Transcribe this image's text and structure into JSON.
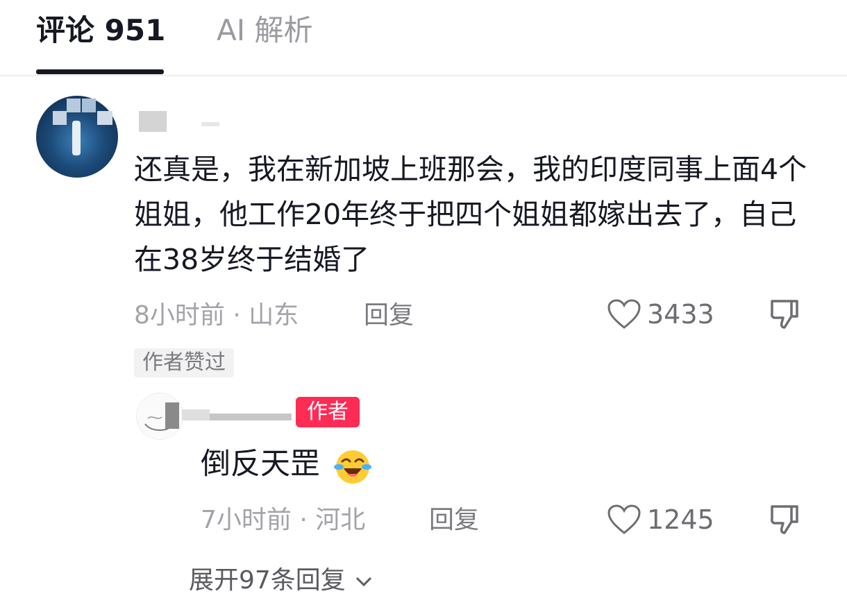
{
  "tabs": [
    {
      "label": "评论 951",
      "active": true
    },
    {
      "label": "AI 解析",
      "active": false
    }
  ],
  "comment": {
    "text": "还真是，我在新加坡上班那会，我的印度同事上面4个姐姐，他工作20年终于把四个姐姐都嫁出去了，自己在38岁终于结婚了",
    "time": "8小时前",
    "location": "山东",
    "reply_label": "回复",
    "likes": "3433",
    "author_liked_badge": "作者赞过"
  },
  "reply": {
    "author_badge": "作者",
    "text": "倒反天罡",
    "emoji": "laughing-crying-emoji",
    "time": "7小时前",
    "location": "河北",
    "reply_label": "回复",
    "likes": "1245"
  },
  "expand_label": "展开97条回复",
  "colors": {
    "author_badge": "#fe2c55",
    "text": "#161823",
    "muted": "#a3a3a8"
  }
}
